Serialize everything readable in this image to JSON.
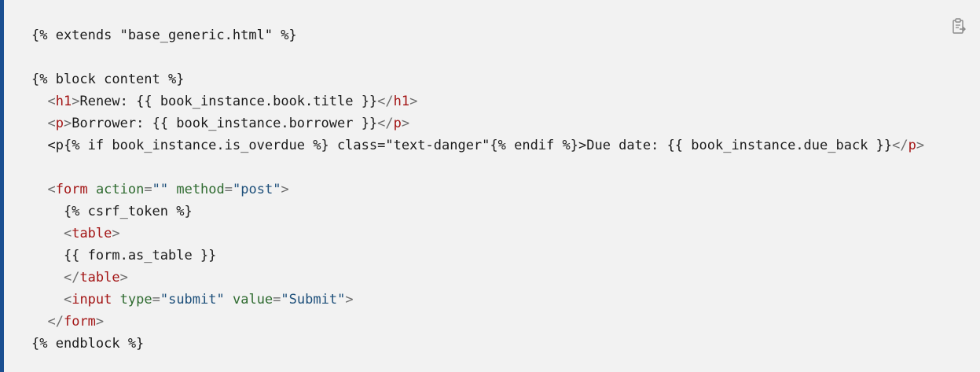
{
  "code_lines": [
    [
      {
        "t": "{% extends \"base_generic.html\" %}",
        "c": "tok-text"
      }
    ],
    [],
    [
      {
        "t": "{% block content %}",
        "c": "tok-text"
      }
    ],
    [
      {
        "t": "  ",
        "c": "tok-text"
      },
      {
        "t": "<",
        "c": "tok-punct"
      },
      {
        "t": "h1",
        "c": "tok-tag"
      },
      {
        "t": ">",
        "c": "tok-punct"
      },
      {
        "t": "Renew: {{ book_instance.book.title }}",
        "c": "tok-text"
      },
      {
        "t": "</",
        "c": "tok-punct"
      },
      {
        "t": "h1",
        "c": "tok-tag"
      },
      {
        "t": ">",
        "c": "tok-punct"
      }
    ],
    [
      {
        "t": "  ",
        "c": "tok-text"
      },
      {
        "t": "<",
        "c": "tok-punct"
      },
      {
        "t": "p",
        "c": "tok-tag"
      },
      {
        "t": ">",
        "c": "tok-punct"
      },
      {
        "t": "Borrower: {{ book_instance.borrower }}",
        "c": "tok-text"
      },
      {
        "t": "</",
        "c": "tok-punct"
      },
      {
        "t": "p",
        "c": "tok-tag"
      },
      {
        "t": ">",
        "c": "tok-punct"
      }
    ],
    [
      {
        "t": "  ",
        "c": "tok-text"
      },
      {
        "t": "<p{% if book_instance.is_overdue %} class=\"text-danger\"{% endif %}>Due date: {{ book_instance.due_back }}",
        "c": "tok-text"
      },
      {
        "t": "</",
        "c": "tok-punct"
      },
      {
        "t": "p",
        "c": "tok-tag"
      },
      {
        "t": ">",
        "c": "tok-punct"
      }
    ],
    [],
    [
      {
        "t": "  ",
        "c": "tok-text"
      },
      {
        "t": "<",
        "c": "tok-punct"
      },
      {
        "t": "form",
        "c": "tok-tag"
      },
      {
        "t": " ",
        "c": "tok-text"
      },
      {
        "t": "action",
        "c": "tok-attr"
      },
      {
        "t": "=",
        "c": "tok-punct"
      },
      {
        "t": "\"\"",
        "c": "tok-val"
      },
      {
        "t": " ",
        "c": "tok-text"
      },
      {
        "t": "method",
        "c": "tok-attr"
      },
      {
        "t": "=",
        "c": "tok-punct"
      },
      {
        "t": "\"post\"",
        "c": "tok-val"
      },
      {
        "t": ">",
        "c": "tok-punct"
      }
    ],
    [
      {
        "t": "    {% csrf_token %}",
        "c": "tok-text"
      }
    ],
    [
      {
        "t": "    ",
        "c": "tok-text"
      },
      {
        "t": "<",
        "c": "tok-punct"
      },
      {
        "t": "table",
        "c": "tok-tag"
      },
      {
        "t": ">",
        "c": "tok-punct"
      }
    ],
    [
      {
        "t": "    {{ form.as_table }}",
        "c": "tok-text"
      }
    ],
    [
      {
        "t": "    ",
        "c": "tok-text"
      },
      {
        "t": "</",
        "c": "tok-punct"
      },
      {
        "t": "table",
        "c": "tok-tag"
      },
      {
        "t": ">",
        "c": "tok-punct"
      }
    ],
    [
      {
        "t": "    ",
        "c": "tok-text"
      },
      {
        "t": "<",
        "c": "tok-punct"
      },
      {
        "t": "input",
        "c": "tok-tag"
      },
      {
        "t": " ",
        "c": "tok-text"
      },
      {
        "t": "type",
        "c": "tok-attr"
      },
      {
        "t": "=",
        "c": "tok-punct"
      },
      {
        "t": "\"submit\"",
        "c": "tok-val"
      },
      {
        "t": " ",
        "c": "tok-text"
      },
      {
        "t": "value",
        "c": "tok-attr"
      },
      {
        "t": "=",
        "c": "tok-punct"
      },
      {
        "t": "\"Submit\"",
        "c": "tok-val"
      },
      {
        "t": ">",
        "c": "tok-punct"
      }
    ],
    [
      {
        "t": "  ",
        "c": "tok-text"
      },
      {
        "t": "</",
        "c": "tok-punct"
      },
      {
        "t": "form",
        "c": "tok-tag"
      },
      {
        "t": ">",
        "c": "tok-punct"
      }
    ],
    [
      {
        "t": "{% endblock %}",
        "c": "tok-text"
      }
    ]
  ],
  "copy_button": {
    "icon": "clipboard-copy-icon"
  },
  "colors": {
    "background": "#f2f2f2",
    "accent_bar": "#1b4f91",
    "tag": "#a31515",
    "attribute": "#2f6b30",
    "value": "#1d4f7a",
    "punctuation": "#6e6e6e",
    "text": "#1b1b1b"
  }
}
